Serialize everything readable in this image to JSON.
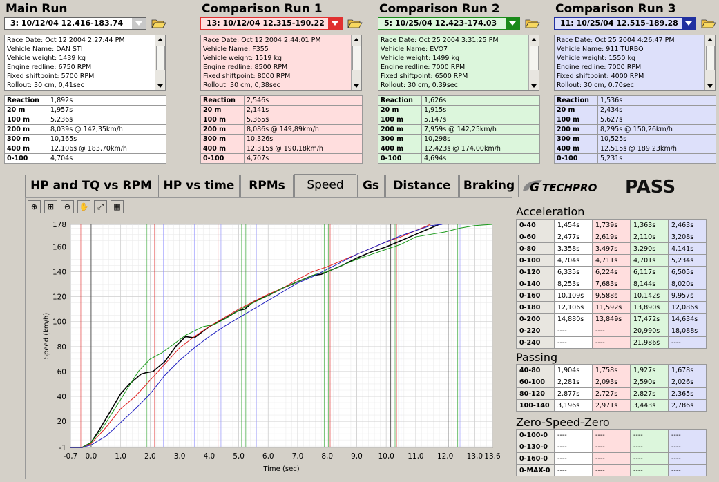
{
  "runs": [
    {
      "title": "Main Run",
      "selection": "3:  10/12/04 12.416-183.74",
      "bg": "#ffffff",
      "accent": "#c8c8c8",
      "info": [
        "Race Date: Oct 12 2004  2:27:44 PM",
        "Vehicle Name: DAN STI",
        "Vehicle weight: 1439 kg",
        "Engine redline: 6750 RPM",
        "Fixed shiftpoint: 5700 RPM",
        "Rollout: 30 cm, 0,41sec"
      ],
      "times": [
        [
          "Reaction",
          "1,892s"
        ],
        [
          "20 m",
          "1,957s"
        ],
        [
          "100 m",
          "5,236s"
        ],
        [
          "200 m",
          "8,039s @ 142,35km/h"
        ],
        [
          "300 m",
          "10,165s"
        ],
        [
          "400 m",
          "12,106s @ 183,70km/h"
        ],
        [
          "0-100",
          "4,704s"
        ]
      ]
    },
    {
      "title": "Comparison Run 1",
      "selection": "13:  10/12/04 12.315-190.22",
      "bg": "#ffdede",
      "accent": "#e03030",
      "info": [
        "Race Date: Oct 12 2004  2:44:01 PM",
        "Vehicle Name: F355",
        "Vehicle weight: 1519 kg",
        "Engine redline: 8500 RPM",
        "Fixed shiftpoint: 8000 RPM",
        "Rollout: 30 cm, 0,38sec"
      ],
      "times": [
        [
          "Reaction",
          "2,546s"
        ],
        [
          "20 m",
          "2,141s"
        ],
        [
          "100 m",
          "5,365s"
        ],
        [
          "200 m",
          "8,086s @ 149,89km/h"
        ],
        [
          "300 m",
          "10,326s"
        ],
        [
          "400 m",
          "12,315s @ 190,18km/h"
        ],
        [
          "0-100",
          "4,707s"
        ]
      ]
    },
    {
      "title": "Comparison Run 2",
      "selection": "5:  10/25/04 12.423-174.03",
      "bg": "#dcf6dc",
      "accent": "#1a8a1a",
      "info": [
        "Race Date: Oct 25 2004  3:31:25 PM",
        "Vehicle Name: EVO7",
        "Vehicle weight: 1499 kg",
        "Engine redline: 7000 RPM",
        "Fixed shiftpoint: 6500 RPM",
        "Rollout: 30 cm, 0.39sec"
      ],
      "times": [
        [
          "Reaction",
          "1,626s"
        ],
        [
          "20 m",
          "1,915s"
        ],
        [
          "100 m",
          "5,147s"
        ],
        [
          "200 m",
          "7,959s @ 142,25km/h"
        ],
        [
          "300 m",
          "10,298s"
        ],
        [
          "400 m",
          "12,423s @ 174,00km/h"
        ],
        [
          "0-100",
          "4,694s"
        ]
      ]
    },
    {
      "title": "Comparison Run 3",
      "selection": "11:  10/25/04 12.515-189.28",
      "bg": "#dde0fa",
      "accent": "#2030a0",
      "info": [
        "Race Date: Oct 25 2004  4:26:47 PM",
        "Vehicle Name: 911 TURBO",
        "Vehicle weight: 1550 kg",
        "Engine redline: 7000 RPM",
        "Fixed shiftpoint: 4000 RPM",
        "Rollout: 30 cm, 0.70sec"
      ],
      "times": [
        [
          "Reaction",
          "1,536s"
        ],
        [
          "20 m",
          "2,434s"
        ],
        [
          "100 m",
          "5,627s"
        ],
        [
          "200 m",
          "8,295s @ 150,26km/h"
        ],
        [
          "300 m",
          "10,525s"
        ],
        [
          "400 m",
          "12,515s @ 189,23km/h"
        ],
        [
          "0-100",
          "5,231s"
        ]
      ]
    }
  ],
  "tabs": [
    "HP and TQ vs RPM",
    "HP vs time",
    "RPMs",
    "Speed",
    "Gs",
    "Distance",
    "Braking"
  ],
  "active_tab": "Speed",
  "logo": {
    "brand": "TECHPRO",
    "mark": "G",
    "product": "PASS"
  },
  "toolbar": [
    "zoom-in",
    "zoom-rect",
    "zoom-out",
    "pan-hand",
    "fit",
    "grid"
  ],
  "acceleration": {
    "title": "Acceleration",
    "rows": [
      [
        "0-40",
        "1,454s",
        "1,739s",
        "1,363s",
        "2,463s"
      ],
      [
        "0-60",
        "2,477s",
        "2,619s",
        "2,110s",
        "3,208s"
      ],
      [
        "0-80",
        "3,358s",
        "3,497s",
        "3,290s",
        "4,141s"
      ],
      [
        "0-100",
        "4,704s",
        "4,711s",
        "4,701s",
        "5,234s"
      ],
      [
        "0-120",
        "6,335s",
        "6,224s",
        "6,117s",
        "6,505s"
      ],
      [
        "0-140",
        "8,253s",
        "7,683s",
        "8,144s",
        "8,020s"
      ],
      [
        "0-160",
        "10,109s",
        "9,588s",
        "10,142s",
        "9,957s"
      ],
      [
        "0-180",
        "12,106s",
        "11,592s",
        "13,890s",
        "12,086s"
      ],
      [
        "0-200",
        "14,880s",
        "13,849s",
        "17,472s",
        "14,634s"
      ],
      [
        "0-220",
        "----",
        "----",
        "20,990s",
        "18,088s"
      ],
      [
        "0-240",
        "----",
        "----",
        "21,986s",
        "----"
      ]
    ]
  },
  "passing": {
    "title": "Passing",
    "rows": [
      [
        "40-80",
        "1,904s",
        "1,758s",
        "1,927s",
        "1,678s"
      ],
      [
        "60-100",
        "2,281s",
        "2,093s",
        "2,590s",
        "2,026s"
      ],
      [
        "80-120",
        "2,877s",
        "2,727s",
        "2,827s",
        "2,365s"
      ],
      [
        "100-140",
        "3,196s",
        "2,971s",
        "3,443s",
        "2,786s"
      ]
    ]
  },
  "zsz": {
    "title": "Zero-Speed-Zero",
    "rows": [
      [
        "0-100-0",
        "----",
        "----",
        "----",
        "----"
      ],
      [
        "0-130-0",
        "----",
        "----",
        "----",
        "----"
      ],
      [
        "0-160-0",
        "----",
        "----",
        "----",
        "----"
      ],
      [
        "0-MAX-0",
        "----",
        "----",
        "----",
        "----"
      ]
    ]
  },
  "chart_data": {
    "type": "line",
    "xlabel": "Time (sec)",
    "ylabel": "Speed (km/h)",
    "xlim": [
      -0.7,
      13.6
    ],
    "ylim": [
      -1,
      178
    ],
    "xticks": [
      "-0,7",
      "0,0",
      "1,0",
      "2,0",
      "3,0",
      "4,0",
      "5,0",
      "6,0",
      "7,0",
      "8,0",
      "9,0",
      "10,0",
      "11,0",
      "12,0",
      "13,0",
      "13,6"
    ],
    "xtick_values": [
      -0.7,
      0,
      1,
      2,
      3,
      4,
      5,
      6,
      7,
      8,
      9,
      10,
      11,
      12,
      13,
      13.6
    ],
    "yticks": [
      -1,
      20,
      40,
      60,
      80,
      100,
      120,
      140,
      160,
      178
    ],
    "grid": true,
    "series": [
      {
        "color": "#000000",
        "width": 1.6,
        "x": [
          -0.7,
          -0.3,
          0,
          0.3,
          0.7,
          1,
          1.3,
          1.7,
          1.85,
          2.1,
          2.5,
          2.9,
          3.2,
          3.5,
          4,
          4.5,
          5,
          5.2,
          5.5,
          6,
          6.5,
          7,
          7.5,
          7.8,
          8,
          8.5,
          9,
          9.5,
          10,
          10.5,
          11,
          11.5,
          11.8
        ],
        "y": [
          -1,
          -1,
          3,
          14,
          30,
          42,
          50,
          58,
          59,
          60,
          68,
          81,
          88,
          87,
          96,
          102,
          109,
          110,
          116,
          121,
          127,
          132,
          137,
          138,
          140,
          145,
          151,
          156,
          160,
          165,
          170,
          175,
          178
        ]
      },
      {
        "color": "#e02020",
        "width": 1,
        "x": [
          -0.7,
          -0.3,
          0,
          0.5,
          1,
          1.5,
          2,
          2.5,
          3,
          3.5,
          4,
          4.5,
          5,
          5.5,
          6,
          6.5,
          7,
          7.5,
          8,
          8.5,
          9,
          9.5,
          10,
          10.5,
          11,
          11.5
        ],
        "y": [
          -1,
          -1,
          2,
          15,
          30,
          40,
          53,
          66,
          79,
          88,
          96,
          103,
          110,
          116,
          122,
          127,
          134,
          140,
          144,
          149,
          154,
          159,
          164,
          168,
          173,
          178
        ]
      },
      {
        "color": "#1a9a1a",
        "width": 1,
        "x": [
          -0.7,
          -0.3,
          0,
          0.4,
          0.8,
          1.2,
          1.6,
          2,
          2.4,
          2.8,
          3.2,
          3.8,
          4.2,
          4.6,
          5,
          5.4,
          6,
          6.5,
          7,
          7.6,
          8,
          8.5,
          9,
          9.5,
          10,
          10.5,
          11,
          11.5,
          12,
          12.5,
          13,
          13.6
        ],
        "y": [
          -1,
          -1,
          3,
          15,
          30,
          45,
          60,
          70,
          75,
          82,
          89,
          96,
          98,
          103,
          109,
          114,
          121,
          127,
          132,
          138,
          140,
          145,
          150,
          154,
          158,
          162,
          168,
          170,
          172,
          175,
          177,
          180
        ]
      },
      {
        "color": "#2020c0",
        "width": 1,
        "x": [
          -0.7,
          -0.3,
          0,
          0.5,
          1,
          1.5,
          2,
          2.5,
          3,
          3.5,
          4,
          4.5,
          5,
          5.5,
          6,
          6.5,
          7,
          7.5,
          8,
          8.5,
          9,
          9.5,
          10,
          10.5,
          11,
          11.5,
          11.9
        ],
        "y": [
          -1,
          -1,
          1,
          8,
          19,
          30,
          42,
          57,
          69,
          79,
          88,
          96,
          103,
          110,
          117,
          124,
          131,
          136,
          142,
          148,
          154,
          159,
          164,
          169,
          173,
          177,
          180
        ]
      }
    ],
    "vlines": [
      {
        "x": -0.35,
        "color": "#e02020"
      },
      {
        "x": 0,
        "color": "#000000"
      },
      {
        "x": 1.88,
        "color": "#1a9a1a"
      },
      {
        "x": 1.93,
        "color": "#1a9a1a"
      },
      {
        "x": 2.15,
        "color": "#e02020"
      },
      {
        "x": 2.45,
        "color": "#8888ff"
      },
      {
        "x": 3.5,
        "color": "#8888ff"
      },
      {
        "x": 4.3,
        "color": "#e02020"
      },
      {
        "x": 4.4,
        "color": "#8888ff"
      },
      {
        "x": 5.1,
        "color": "#1a9a1a"
      },
      {
        "x": 5.24,
        "color": "#1a9a1a"
      },
      {
        "x": 5.35,
        "color": "#e02020"
      },
      {
        "x": 5.6,
        "color": "#8888ff"
      },
      {
        "x": 7.9,
        "color": "#1a9a1a"
      },
      {
        "x": 8.04,
        "color": "#1a9a1a"
      },
      {
        "x": 8.1,
        "color": "#e02020"
      },
      {
        "x": 8.3,
        "color": "#8888ff"
      },
      {
        "x": 10.15,
        "color": "#000000"
      },
      {
        "x": 10.3,
        "color": "#1a9a1a"
      },
      {
        "x": 10.35,
        "color": "#e02020"
      },
      {
        "x": 10.5,
        "color": "#8888ff"
      },
      {
        "x": 12.1,
        "color": "#000000"
      },
      {
        "x": 12.3,
        "color": "#e02020"
      },
      {
        "x": 12.42,
        "color": "#1a9a1a"
      },
      {
        "x": 12.5,
        "color": "#8888ff"
      }
    ]
  }
}
